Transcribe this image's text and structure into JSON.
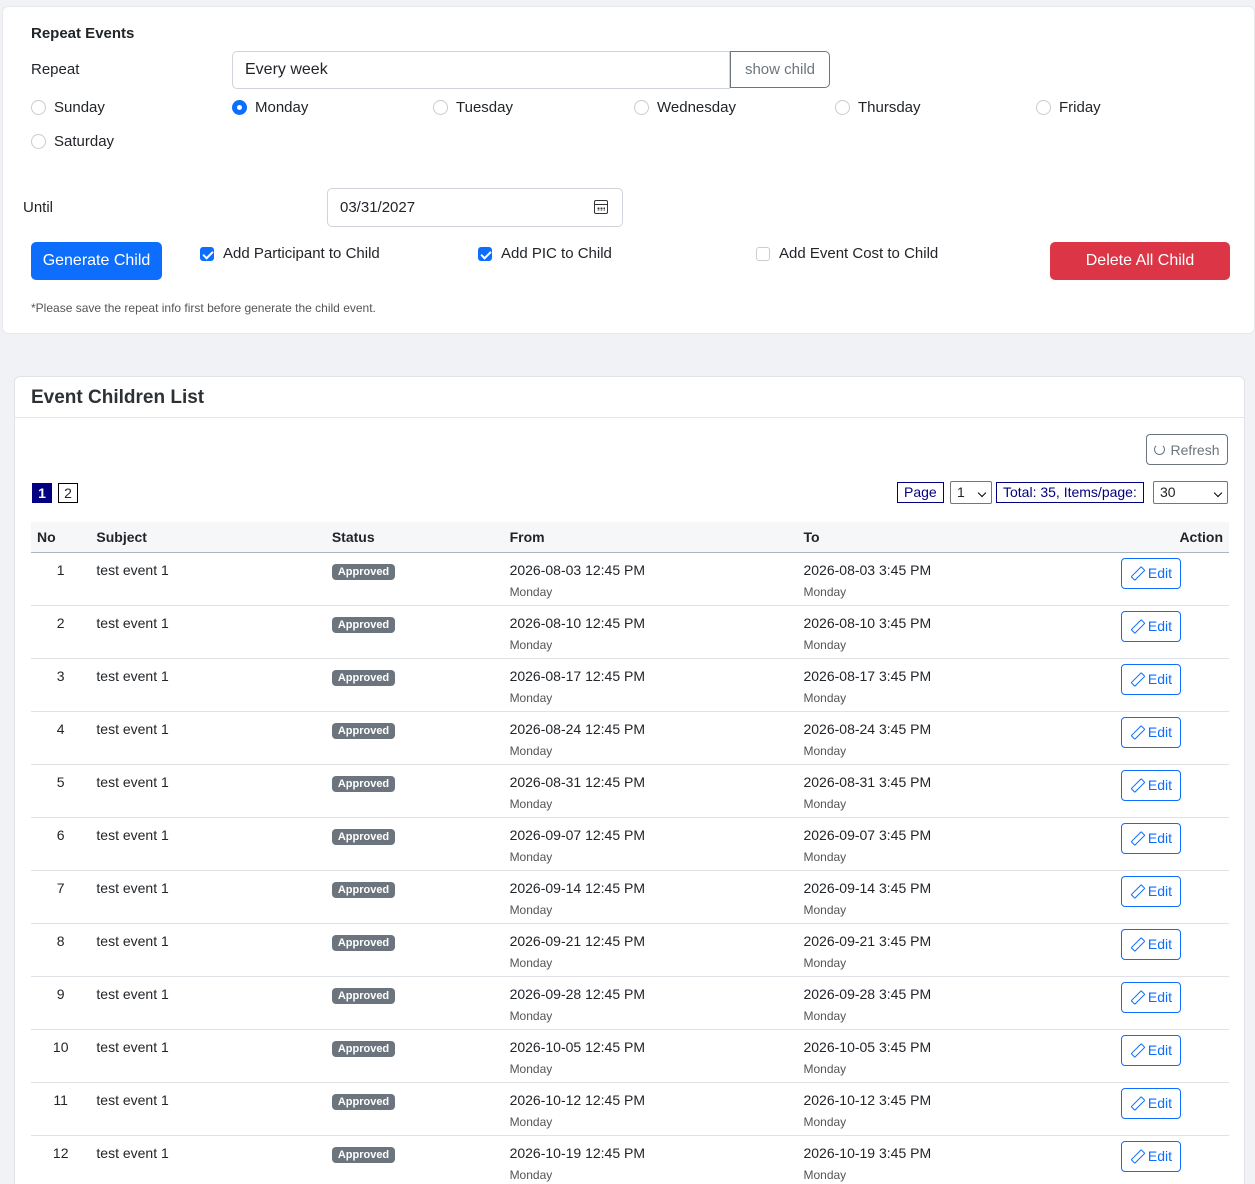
{
  "repeat_events": {
    "title": "Repeat Events",
    "repeat_label": "Repeat",
    "repeat_value": "Every week",
    "show_child_label": "show child",
    "days": [
      {
        "label": "Sunday",
        "checked": false
      },
      {
        "label": "Monday",
        "checked": true
      },
      {
        "label": "Tuesday",
        "checked": false
      },
      {
        "label": "Wednesday",
        "checked": false
      },
      {
        "label": "Thursday",
        "checked": false
      },
      {
        "label": "Friday",
        "checked": false
      },
      {
        "label": "Saturday",
        "checked": false
      }
    ],
    "until_label": "Until",
    "until_value": "03/31/2027",
    "generate_label": "Generate Child",
    "options": [
      {
        "label": "Add Participant to Child",
        "checked": true
      },
      {
        "label": "Add PIC to Child",
        "checked": true
      },
      {
        "label": "Add Event Cost to Child",
        "checked": false
      }
    ],
    "delete_label": "Delete All Child",
    "note": "*Please save the repeat info first before generate the child event."
  },
  "children_list": {
    "title": "Event Children List",
    "refresh_label": "Refresh",
    "pages": [
      "1",
      "2"
    ],
    "current_page": "1",
    "page_label": "Page",
    "page_select_value": "1",
    "total_label": "Total: 35, Items/page:",
    "items_per_page": "30",
    "columns": [
      "No",
      "Subject",
      "Status",
      "From",
      "To",
      "Action"
    ],
    "edit_label": "Edit",
    "rows": [
      {
        "no": "1",
        "subject": "test event 1",
        "status": "Approved",
        "from": "2026-08-03 12:45 PM",
        "from_day": "Monday",
        "to": "2026-08-03 3:45 PM",
        "to_day": "Monday"
      },
      {
        "no": "2",
        "subject": "test event 1",
        "status": "Approved",
        "from": "2026-08-10 12:45 PM",
        "from_day": "Monday",
        "to": "2026-08-10 3:45 PM",
        "to_day": "Monday"
      },
      {
        "no": "3",
        "subject": "test event 1",
        "status": "Approved",
        "from": "2026-08-17 12:45 PM",
        "from_day": "Monday",
        "to": "2026-08-17 3:45 PM",
        "to_day": "Monday"
      },
      {
        "no": "4",
        "subject": "test event 1",
        "status": "Approved",
        "from": "2026-08-24 12:45 PM",
        "from_day": "Monday",
        "to": "2026-08-24 3:45 PM",
        "to_day": "Monday"
      },
      {
        "no": "5",
        "subject": "test event 1",
        "status": "Approved",
        "from": "2026-08-31 12:45 PM",
        "from_day": "Monday",
        "to": "2026-08-31 3:45 PM",
        "to_day": "Monday"
      },
      {
        "no": "6",
        "subject": "test event 1",
        "status": "Approved",
        "from": "2026-09-07 12:45 PM",
        "from_day": "Monday",
        "to": "2026-09-07 3:45 PM",
        "to_day": "Monday"
      },
      {
        "no": "7",
        "subject": "test event 1",
        "status": "Approved",
        "from": "2026-09-14 12:45 PM",
        "from_day": "Monday",
        "to": "2026-09-14 3:45 PM",
        "to_day": "Monday"
      },
      {
        "no": "8",
        "subject": "test event 1",
        "status": "Approved",
        "from": "2026-09-21 12:45 PM",
        "from_day": "Monday",
        "to": "2026-09-21 3:45 PM",
        "to_day": "Monday"
      },
      {
        "no": "9",
        "subject": "test event 1",
        "status": "Approved",
        "from": "2026-09-28 12:45 PM",
        "from_day": "Monday",
        "to": "2026-09-28 3:45 PM",
        "to_day": "Monday"
      },
      {
        "no": "10",
        "subject": "test event 1",
        "status": "Approved",
        "from": "2026-10-05 12:45 PM",
        "from_day": "Monday",
        "to": "2026-10-05 3:45 PM",
        "to_day": "Monday"
      },
      {
        "no": "11",
        "subject": "test event 1",
        "status": "Approved",
        "from": "2026-10-12 12:45 PM",
        "from_day": "Monday",
        "to": "2026-10-12 3:45 PM",
        "to_day": "Monday"
      },
      {
        "no": "12",
        "subject": "test event 1",
        "status": "Approved",
        "from": "2026-10-19 12:45 PM",
        "from_day": "Monday",
        "to": "2026-10-19 3:45 PM",
        "to_day": "Monday"
      }
    ]
  }
}
